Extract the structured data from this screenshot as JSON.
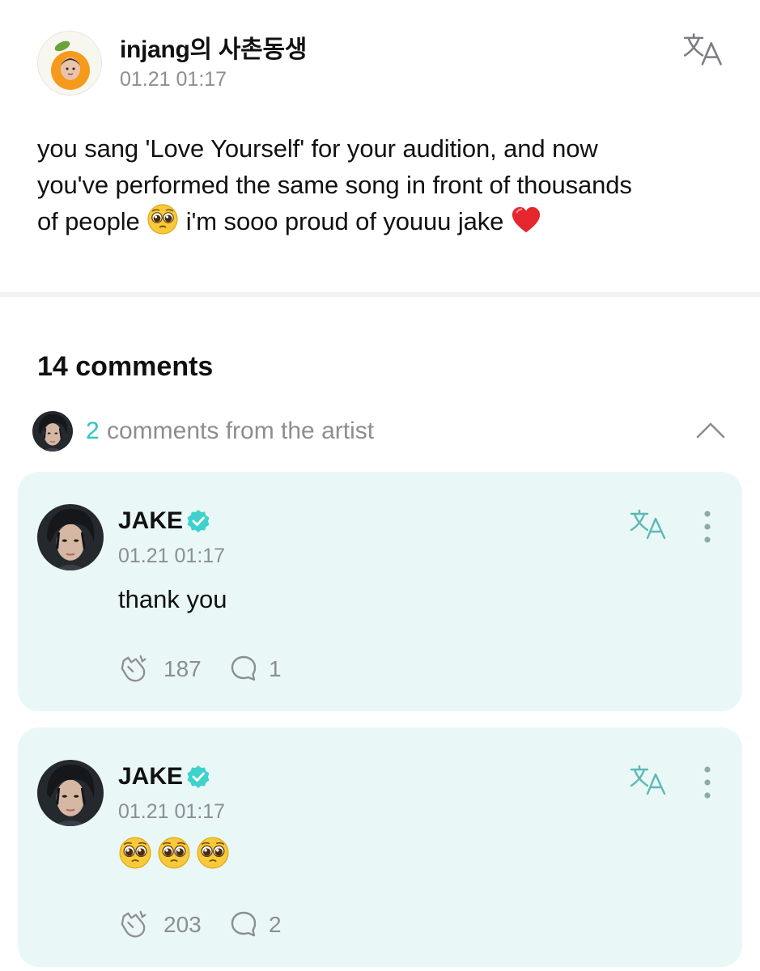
{
  "post": {
    "author": "injang의 사촌동생",
    "time": "01.21 01:17",
    "body_line1": "you sang 'Love Yourself' for your audition, and now",
    "body_line2": "you've performed the same song in front of thousands",
    "body_line3a": "of people",
    "body_line3b": "i'm sooo proud of youuu jake"
  },
  "comments": {
    "count_label": "14 comments",
    "artist_count": "2",
    "artist_label": "comments from the artist"
  },
  "artist_comments": [
    {
      "name": "JAKE",
      "time": "01.21 01:17",
      "text": "thank you",
      "likes": "187",
      "replies": "1"
    },
    {
      "name": "JAKE",
      "time": "01.21 01:17",
      "text": "",
      "likes": "203",
      "replies": "2"
    }
  ],
  "colors": {
    "accent": "#2bc4c0",
    "card_bg": "#e9f8f6",
    "muted": "#8d8d93"
  }
}
